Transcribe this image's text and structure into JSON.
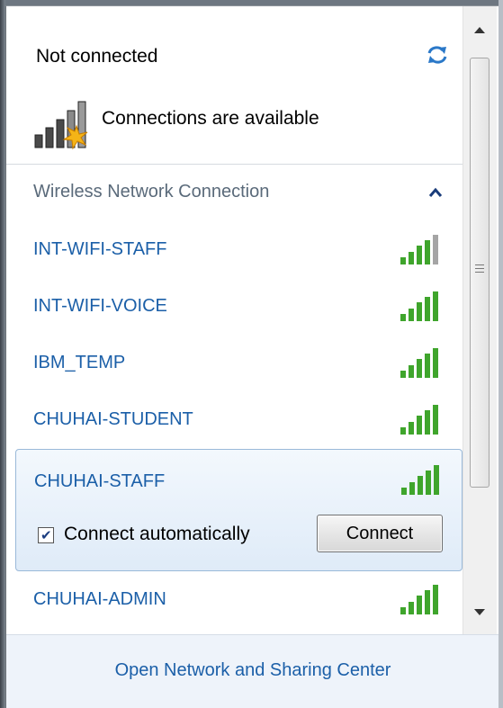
{
  "status": {
    "title": "Not connected",
    "subtitle": "Connections are available",
    "refresh_icon": "refresh-arrows-icon",
    "availability_icon": "signal-bars-with-star-icon"
  },
  "section": {
    "title": "Wireless Network Connection",
    "toggle_icon": "chevron-up-icon"
  },
  "networks": [
    {
      "name": "INT-WIFI-STAFF",
      "signal_bars": 4,
      "signal_max": 5
    },
    {
      "name": "INT-WIFI-VOICE",
      "signal_bars": 5,
      "signal_max": 5
    },
    {
      "name": "IBM_TEMP",
      "signal_bars": 5,
      "signal_max": 5
    },
    {
      "name": "CHUHAI-STUDENT",
      "signal_bars": 5,
      "signal_max": 5
    },
    {
      "name": "CHUHAI-STAFF",
      "signal_bars": 5,
      "signal_max": 5,
      "selected": true
    },
    {
      "name": "CHUHAI-ADMIN",
      "signal_bars": 5,
      "signal_max": 5
    }
  ],
  "selected_network": {
    "connect_automatically_label": "Connect automatically",
    "connect_automatically_checked": true,
    "connect_button_label": "Connect"
  },
  "footer": {
    "link_label": "Open Network and Sharing Center"
  },
  "colors": {
    "link": "#1b5fa8",
    "signal_green": "#3fa52c",
    "signal_gray": "#9a9a9a",
    "selected_bg": "#e6f0fb"
  }
}
